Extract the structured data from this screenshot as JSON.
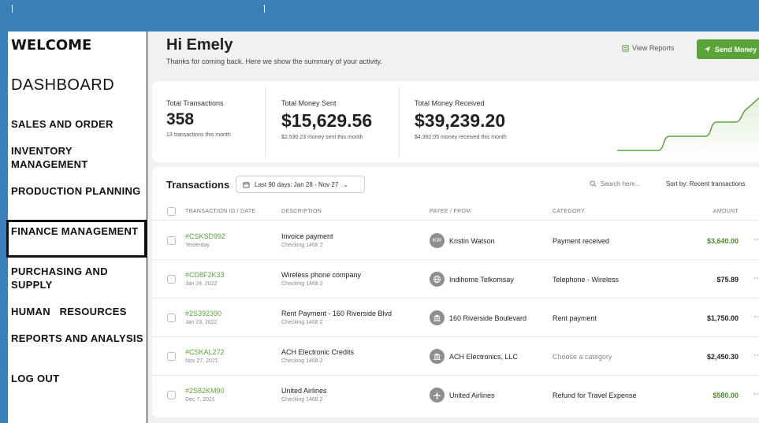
{
  "sidebar": {
    "welcome": "WELCOME",
    "dashboard": "DASHBOARD",
    "items": [
      {
        "label": "SALES AND ORDER"
      },
      {
        "label": "INVENTORY MANAGEMENT"
      },
      {
        "label": "PRODUCTION PLANNING"
      },
      {
        "label": "FINANCE MANAGEMENT"
      },
      {
        "label": "PURCHASING AND SUPPLY"
      },
      {
        "label": "HUMAN   RESOURCES"
      },
      {
        "label": "REPORTS AND ANALYSIS"
      },
      {
        "label": "LOG OUT"
      }
    ]
  },
  "header": {
    "greeting": "Hi Emely",
    "subtitle": "Thanks for coming back. Here we show the summary of your activity.",
    "view_reports": "View Reports",
    "send_money": "Send Money"
  },
  "stats": {
    "total_transactions": {
      "label": "Total Transactions",
      "value": "358",
      "sub": "13 transactions this month"
    },
    "money_sent": {
      "label": "Total Money Sent",
      "value": "$15,629.56",
      "sub": "$2,530.23 money sent this month"
    },
    "money_received": {
      "label": "Total Money Received",
      "value": "$39,239.20",
      "sub": "$4,392.05 money received this month"
    }
  },
  "transactions": {
    "title": "Transactions",
    "date_range": "Last 90 days: Jan 28 - Nov 27",
    "search_placeholder": "Search here...",
    "sort_by": "Sort by: Recent transactions",
    "columns": {
      "id_date": "TRANSACTION ID / DATE",
      "description": "DESCRIPTION",
      "payee": "PAYEE / FROM",
      "category": "CATEGORY",
      "amount": "AMOUNT"
    },
    "rows": [
      {
        "id": "#CSKSD992",
        "date": "Yesterday",
        "description": "Invoice payment",
        "account": "Checking 1468 2",
        "avatar": "KW",
        "payee": "Kristin Watson",
        "category": "Payment received",
        "amount": "$3,640.00"
      },
      {
        "id": "#CD8F2K33",
        "date": "Jan 24, 2022",
        "description": "Wireless phone company",
        "account": "Checking 1468 2",
        "avatar": "",
        "payee": "Indihome Telkomsay",
        "category": "Telephone - Wireless",
        "amount": "$75.89"
      },
      {
        "id": "#2S392390",
        "date": "Jan 23, 2022",
        "description": "Rent Payment - 160 Riverside Blvd",
        "account": "Checking 1468 2",
        "avatar": "",
        "payee": "160 Riverside Boulevard",
        "category": "Rent payment",
        "amount": "$1,750.00"
      },
      {
        "id": "#CSKAL272",
        "date": "Nov 27, 2021",
        "description": "ACH Electronic Credits",
        "account": "Checking 1468 2",
        "avatar": "",
        "payee": "ACH Electronics, LLC",
        "category": "Choose a category",
        "amount": "$2,450.30"
      },
      {
        "id": "#2S82KM90",
        "date": "Dec 7, 2021",
        "description": "United Airlines",
        "account": "Checking 1468 2",
        "avatar": "",
        "payee": "United Airlines",
        "category": "Refund for Travel Expense",
        "amount": "$580.00"
      }
    ]
  },
  "colors": {
    "accent": "#5aa53a",
    "frame": "#3a7fb8",
    "panel": "#f1f2f0"
  }
}
